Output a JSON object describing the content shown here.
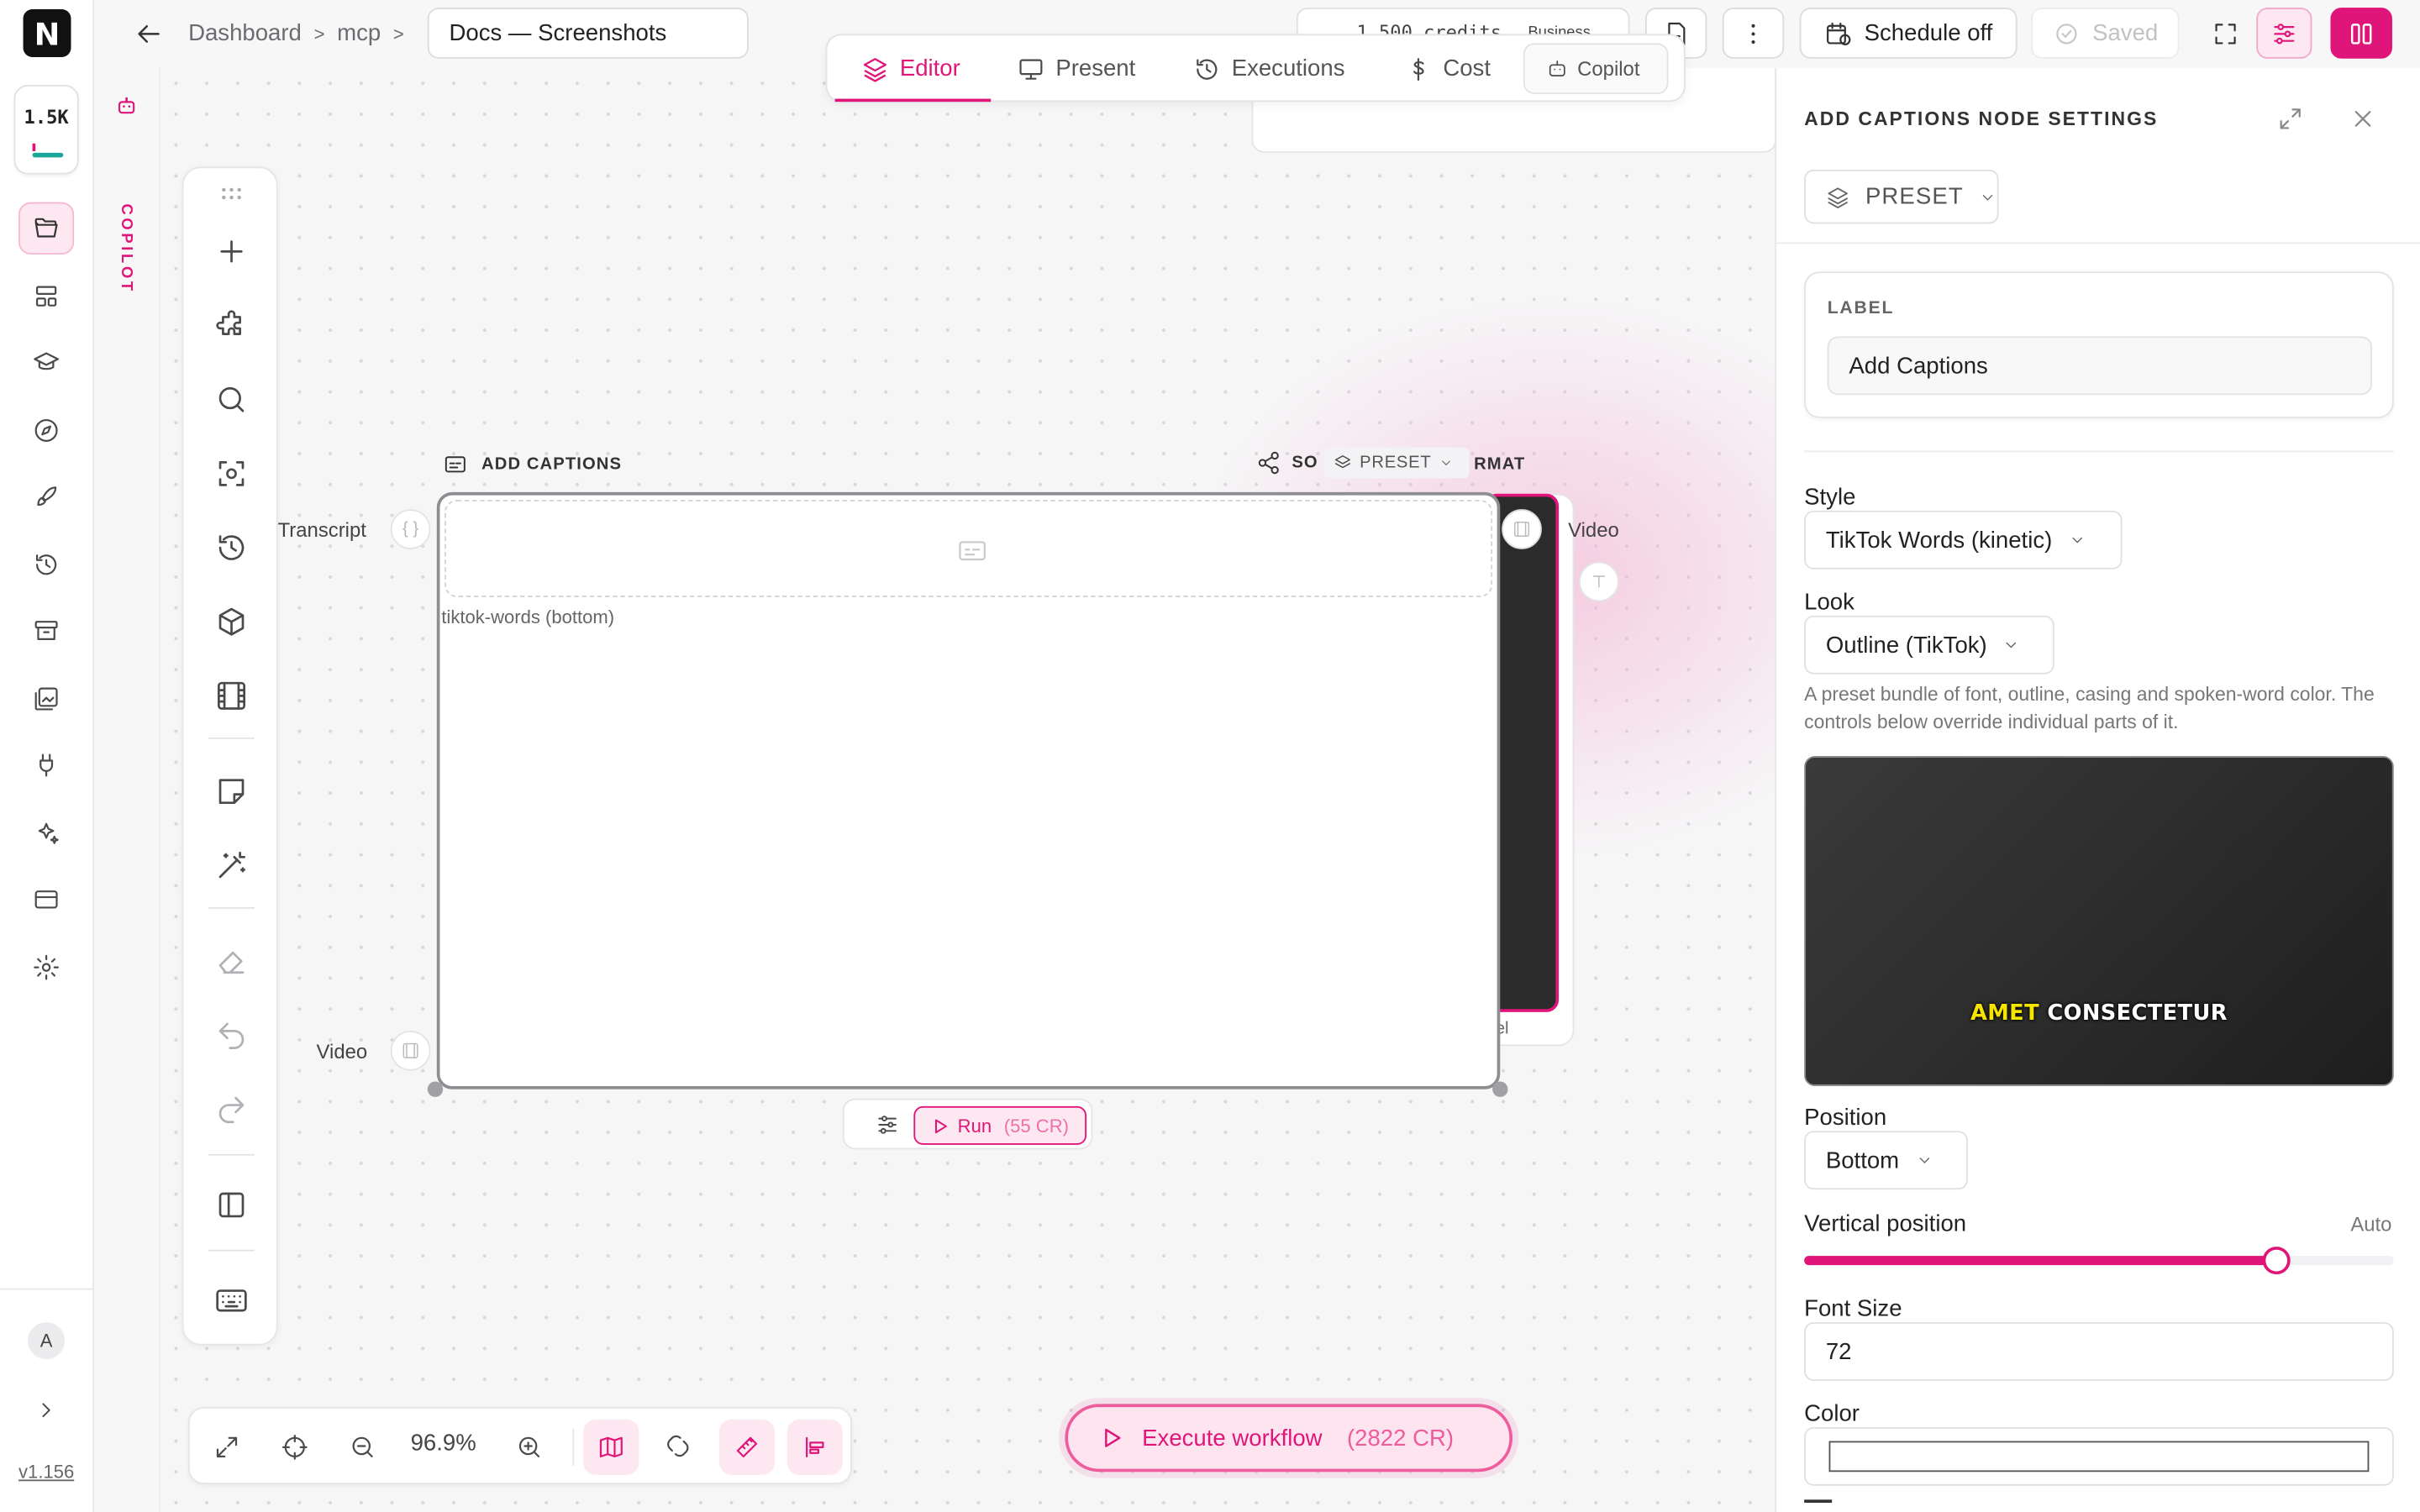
{
  "app": {
    "logo_letter": "N",
    "version": "v1.156"
  },
  "credits_badge": {
    "value": "1.5K"
  },
  "breadcrumb": {
    "items": [
      "Dashboard",
      "mcp"
    ],
    "separator": ">"
  },
  "document": {
    "title": "Docs — Screenshots"
  },
  "header": {
    "credits_text": "1 500 credits",
    "plan_text": "Business",
    "schedule_label": "Schedule off",
    "saved_label": "Saved"
  },
  "mode_tabs": [
    {
      "label": "Editor",
      "active": true,
      "icon": "layers-icon"
    },
    {
      "label": "Present",
      "active": false,
      "icon": "monitor-icon"
    },
    {
      "label": "Executions",
      "active": false,
      "icon": "history-icon"
    },
    {
      "label": "Cost",
      "active": false,
      "icon": "dollar-icon"
    },
    {
      "label": "Copilot",
      "active": false,
      "icon": "robot-icon"
    }
  ],
  "copilot_strip": {
    "label": "COPILOT"
  },
  "user": {
    "initial": "A"
  },
  "canvas": {
    "zoom": "96.9%",
    "node": {
      "title": "ADD CAPTIONS",
      "subtitle": "tiktok-words (bottom)",
      "ports": {
        "input_transcript": "Transcript",
        "input_video": "Video"
      },
      "run_label": "Run",
      "run_cost": "(55 CR)"
    },
    "back_node": {
      "title_start": "SO",
      "title_end": "RMAT",
      "preset_label": "PRESET",
      "output_label": "Video",
      "label_tail": "el"
    },
    "execute": {
      "label": "Execute workflow",
      "cost": "(2822 CR)"
    }
  },
  "panel": {
    "title": "ADD CAPTIONS NODE SETTINGS",
    "preset_label": "PRESET",
    "label_section": {
      "heading": "LABEL",
      "value": "Add Captions"
    },
    "style": {
      "label": "Style",
      "value": "TikTok Words (kinetic)"
    },
    "look": {
      "label": "Look",
      "value": "Outline (TikTok)",
      "help": "A preset bundle of font, outline, casing and spoken-word color. The controls below override individual parts of it."
    },
    "preview": {
      "word_highlight": "AMET",
      "word_rest": "CONSECTETUR",
      "highlight_color": "#f5e400"
    },
    "position": {
      "label": "Position",
      "value": "Bottom"
    },
    "vertical_position": {
      "label": "Vertical position",
      "auto_label": "Auto",
      "level": 0.8
    },
    "font_size": {
      "label": "Font Size",
      "value": "72"
    },
    "color": {
      "label": "Color",
      "value": ""
    }
  },
  "colors": {
    "accent": "#e0157a",
    "accent_soft": "#fde8f1"
  }
}
